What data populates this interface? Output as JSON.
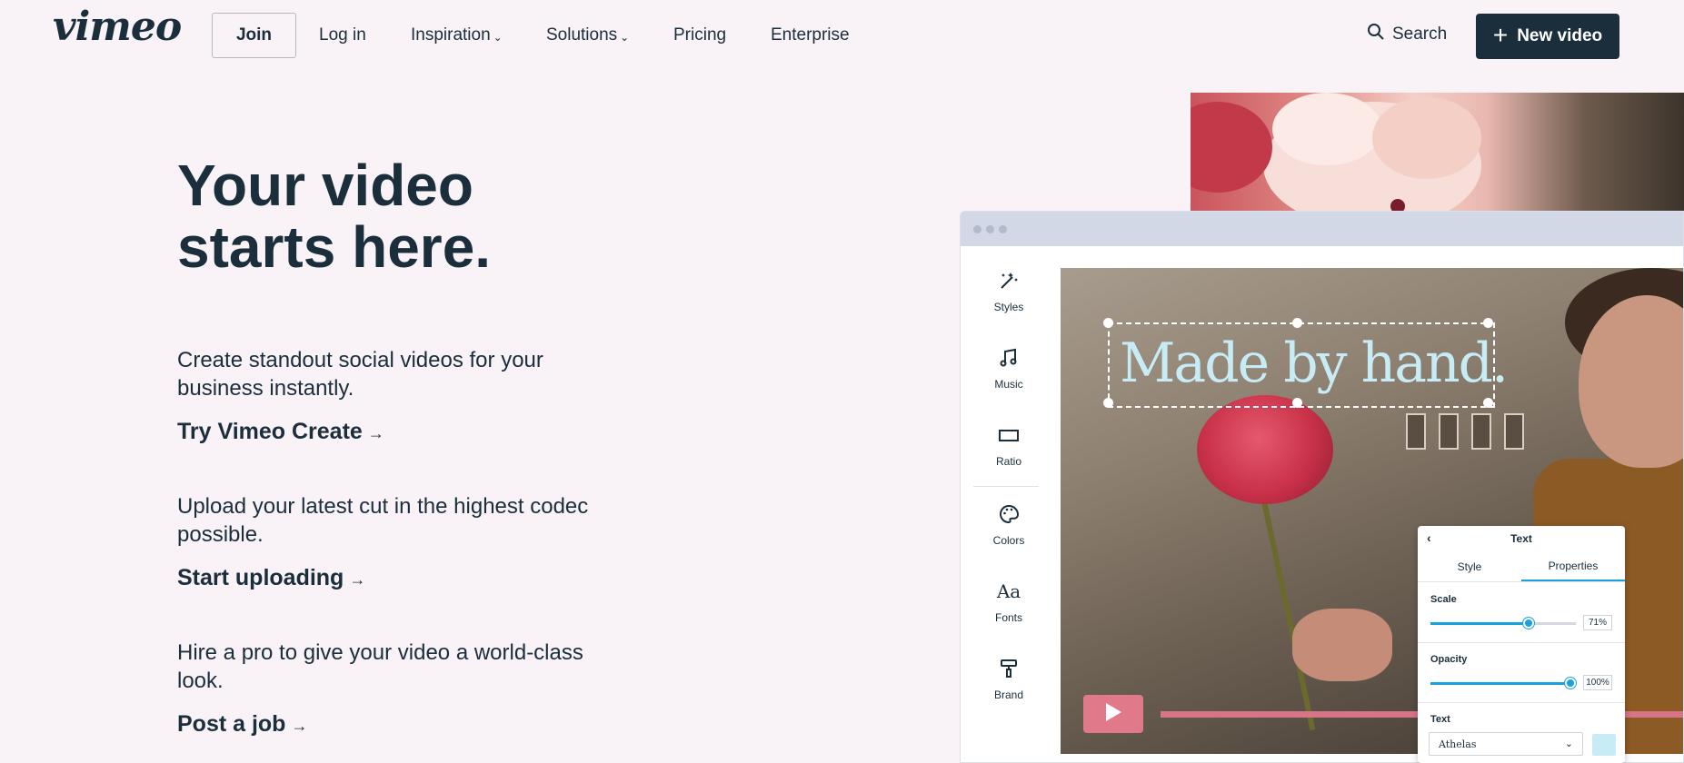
{
  "header": {
    "logo": "vimeo",
    "join": "Join",
    "login": "Log in",
    "nav": [
      {
        "label": "Inspiration",
        "dropdown": true
      },
      {
        "label": "Solutions",
        "dropdown": true
      },
      {
        "label": "Pricing",
        "dropdown": false
      },
      {
        "label": "Enterprise",
        "dropdown": false
      }
    ],
    "search": "Search",
    "new_video": "New video"
  },
  "hero": {
    "title_line1": "Your video",
    "title_line2": "starts here."
  },
  "blocks": [
    {
      "text": "Create standout social videos for your business instantly.",
      "link": "Try Vimeo Create"
    },
    {
      "text": "Upload your latest cut in the highest codec possible.",
      "link": "Start uploading"
    },
    {
      "text": "Hire a pro to give your video a world-class look.",
      "link": "Post a job"
    }
  ],
  "editor": {
    "tools": [
      {
        "label": "Styles",
        "icon": "magic-wand-icon"
      },
      {
        "label": "Music",
        "icon": "music-note-icon"
      },
      {
        "label": "Ratio",
        "icon": "ratio-rectangle-icon"
      },
      {
        "label": "Colors",
        "icon": "palette-icon"
      },
      {
        "label": "Fonts",
        "icon": "fonts-icon"
      },
      {
        "label": "Brand",
        "icon": "paint-roller-icon"
      }
    ],
    "overlay_text": "Made by hand."
  },
  "text_panel": {
    "title": "Text",
    "tabs": [
      "Style",
      "Properties"
    ],
    "active_tab": "Properties",
    "scale_label": "Scale",
    "scale_value": "71%",
    "scale_fraction": 0.71,
    "opacity_label": "Opacity",
    "opacity_value": "100%",
    "opacity_fraction": 1.0,
    "text_label": "Text",
    "font": "Athelas",
    "text_color": "#c7ecf6"
  },
  "colors": {
    "background": "#f9f2f6",
    "primary_dark": "#1a2e3b",
    "accent_blue": "#19a2e0",
    "play_pink": "#e07a8a"
  }
}
